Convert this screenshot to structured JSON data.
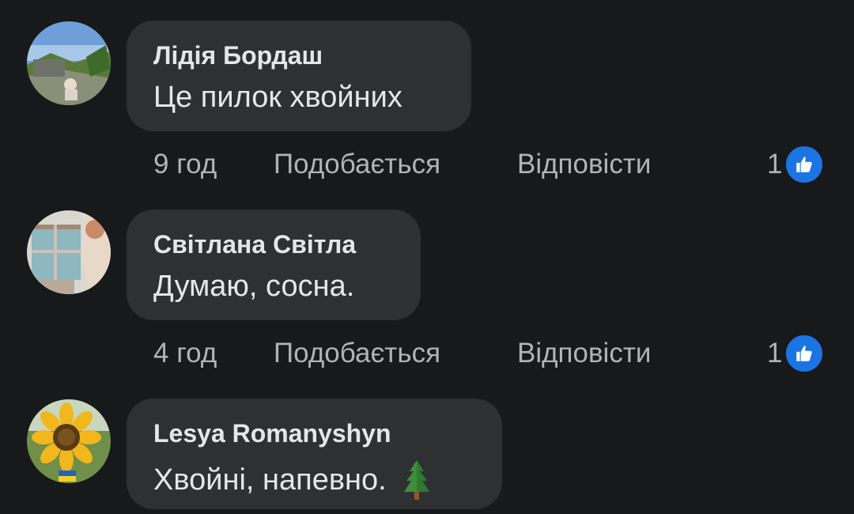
{
  "comments": [
    {
      "author": "Лідія Бордаш",
      "text": "Це пилок хвойних",
      "time": "9 год",
      "like_label": "Подобається",
      "reply_label": "Відповісти",
      "reaction_count": "1",
      "reaction_icon": "thumbs-up-icon",
      "avatar": "landscape-photo"
    },
    {
      "author": "Світлана Світла",
      "text": "Думаю, сосна.",
      "time": "4 год",
      "like_label": "Подобається",
      "reply_label": "Відповісти",
      "reaction_count": "1",
      "reaction_icon": "thumbs-up-icon",
      "avatar": "window-photo"
    },
    {
      "author": "Lesya Romanyshyn",
      "text": "Хвойні, напевно.",
      "emoji": "evergreen-tree-icon",
      "avatar": "sunflower-photo"
    }
  ],
  "colors": {
    "background": "#18191a",
    "bubble": "#2f3031",
    "primary_text": "#e4e6eb",
    "secondary_text": "#b0b3b8",
    "like_blue": "#1b74e4"
  }
}
